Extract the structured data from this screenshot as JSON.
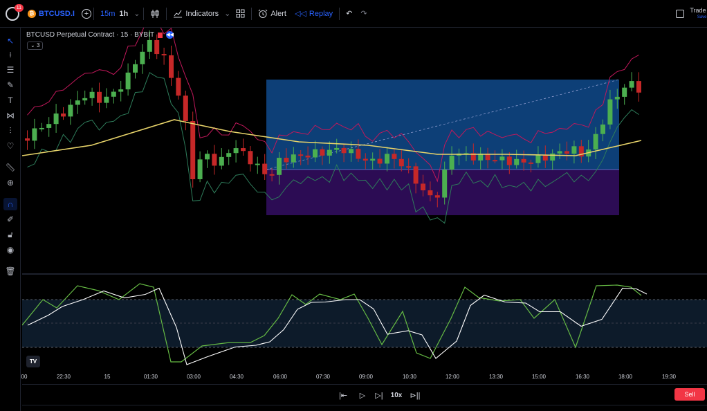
{
  "topbar": {
    "notification_count": "11",
    "symbol": "BTCUSD.I",
    "interval_1": "15m",
    "interval_2": "1h",
    "indicators_label": "Indicators",
    "alert_label": "Alert",
    "replay_label": "Replay",
    "trade_panel_title": "Trade Pr",
    "trade_panel_save": "Save"
  },
  "legend": {
    "title": "BTCUSD Perpetual Contract · 15 · BYBIT",
    "collapse_count": "3"
  },
  "left_tools": [
    "cursor-icon",
    "crosshair-icon",
    "trend-lines-icon",
    "brush-icon",
    "text-icon",
    "patterns-icon",
    "prediction-icon",
    "heart-icon",
    "ruler-icon",
    "zoom-in-icon",
    "magnet-icon",
    "lock-drawing-icon",
    "unlock-icon",
    "eye-icon",
    "trash-icon"
  ],
  "time_axis": [
    "00",
    "22:30",
    "15",
    "01:30",
    "03:00",
    "04:30",
    "06:00",
    "07:30",
    "09:00",
    "10:30",
    "12:00",
    "13:30",
    "15:00",
    "16:30",
    "18:00",
    "19:30"
  ],
  "replay": {
    "speed": "10x",
    "sell_label": "Sell"
  },
  "colors": {
    "up": "#26a69a",
    "up_candle": "#4caf50",
    "down": "#c62828",
    "ma": "#e8d46a",
    "upper_band": "#c2185b",
    "lower_band": "#2e7d5b",
    "accent": "#2962ff",
    "position_profit": "#1565c0",
    "position_loss": "#4a148c"
  }
}
